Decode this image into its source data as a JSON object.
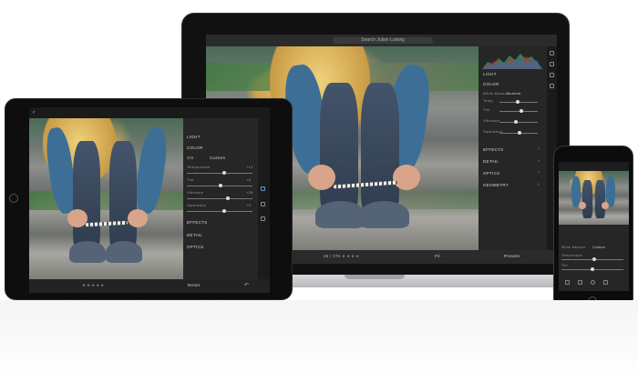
{
  "laptop": {
    "search_placeholder": "Search Julian Ludwig",
    "panel_light": "LIGHT",
    "panel_color": "COLOR",
    "white_balance_label": "White Balance",
    "white_balance_value": "Custom",
    "color_rows": [
      "Temp",
      "Tint",
      "Vibrance",
      "Saturation"
    ],
    "panel_sections": [
      "EFFECTS",
      "DETAIL",
      "OPTICS",
      "GEOMETRY"
    ],
    "bottom_presets": "Presets",
    "bottom_counter": "25 / 27",
    "bottom_fit": "Fit"
  },
  "tablet": {
    "panel_light": "LIGHT",
    "panel_color": "COLOR",
    "wb_label": "WB",
    "wb_value": "Custom",
    "rows": [
      "Temperature",
      "Tint",
      "Vibrance",
      "Saturation"
    ],
    "values": [
      "+14",
      "+5",
      "+28",
      "+9"
    ],
    "sections": [
      "EFFECTS",
      "DETAIL",
      "OPTICS"
    ],
    "reset": "Reset"
  },
  "phone": {
    "wb_label": "White Balance",
    "wb_value": "Custom",
    "rows": [
      "Temperature",
      "Tint"
    ]
  },
  "colors": {
    "dark_ui": "#1f1f1f",
    "panel": "#262626",
    "accent_blue": "#3d6f96"
  }
}
